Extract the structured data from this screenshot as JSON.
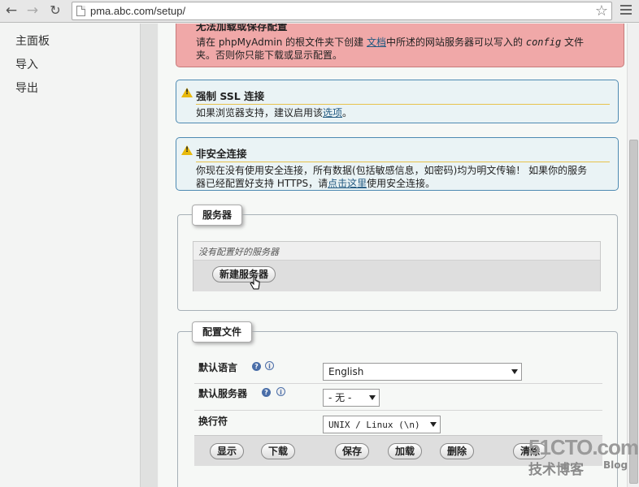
{
  "browser": {
    "url": "pma.abc.com/setup/"
  },
  "left_nav": {
    "items": [
      "主面板",
      "导入",
      "导出"
    ]
  },
  "messages": {
    "config_error": {
      "title": "无法加载或保存配置",
      "line1_pre": "请在 phpMyAdmin 的根文件夹下创建",
      "line1_link": "文档",
      "line1_mid": "中所述的网站服务器可以写入的",
      "line1_code": "config",
      "line1_post": "文件",
      "line2": "夹。否则你只能下载或显示配置。"
    },
    "ssl": {
      "title": "强制 SSL 连接",
      "body_pre": "如果浏览器支持，建议启用该",
      "body_link": "选项",
      "body_post": "。"
    },
    "insecure": {
      "title": "非安全连接",
      "line1": "你现在没有使用安全连接，所有数据(包括敏感信息，如密码)均为明文传输！ 如果你的服务",
      "line2_pre": "器已经配置好支持 HTTPS，请",
      "line2_link": "点击这里",
      "line2_post": "使用安全连接。"
    }
  },
  "servers": {
    "legend": "服务器",
    "empty_text": "没有配置好的服务器",
    "new_button": "新建服务器"
  },
  "config_file": {
    "legend": "配置文件",
    "rows": [
      {
        "label": "默认语言",
        "value": "English"
      },
      {
        "label": "默认服务器",
        "value": "- 无 -"
      },
      {
        "label": "换行符",
        "value": "UNIX / Linux (\\n)"
      }
    ],
    "buttons": {
      "display": "显示",
      "download": "下载",
      "save": "保存",
      "load": "加载",
      "delete": "删除",
      "clear": "清除"
    }
  },
  "watermark": {
    "top": "51CTO.com",
    "bottom": "技术博客",
    "blog": "Blog"
  }
}
